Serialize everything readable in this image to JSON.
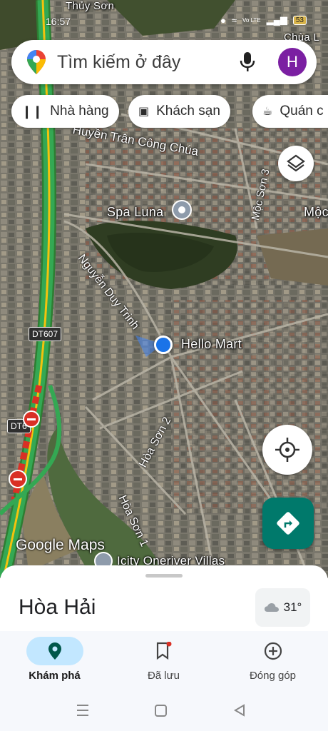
{
  "status_bar": {
    "time": "16:57",
    "network": "Vo LTE",
    "battery": "53"
  },
  "search": {
    "placeholder": "Tìm kiếm ở đây",
    "avatar_letter": "H"
  },
  "chips": [
    {
      "label": "Nhà hàng",
      "icon": "restaurant-icon"
    },
    {
      "label": "Khách sạn",
      "icon": "hotel-icon"
    },
    {
      "label": "Quán c",
      "icon": "cafe-icon"
    }
  ],
  "map": {
    "labels": {
      "thuy_son": "Thủy Sơn",
      "chua_l": "Chùa L",
      "huyen_tran": "Huyền Trân Công Chúa",
      "moc_son_3": "Mộc Sơn 3",
      "moc": "Mộc",
      "spa_luna": "Spa Luna",
      "nguyen_duy_trinh": "Nguyễn Duy Trinh",
      "hello_mart": "Hello Mart",
      "dt607": "DT607",
      "dt6": "DT6",
      "hoa_son_2": "Hòa Sơn 2",
      "hoa_son_1": "Hòa Sơn 1",
      "icity": "Icity Oneriver Villas"
    },
    "watermark": "Google Maps"
  },
  "sheet": {
    "place": "Hòa Hải",
    "temperature": "31°"
  },
  "bottom_nav": [
    {
      "label": "Khám phá",
      "icon": "explore-pin-icon",
      "active": true
    },
    {
      "label": "Đã lưu",
      "icon": "bookmark-icon",
      "active": false
    },
    {
      "label": "Đóng góp",
      "icon": "add-circle-icon",
      "active": false
    }
  ],
  "colors": {
    "accent_teal": "#00796b",
    "avatar_purple": "#7b1fa2",
    "nav_active": "#c2e7ff",
    "location_blue": "#1a73e8",
    "highway_green": "#34a853"
  }
}
